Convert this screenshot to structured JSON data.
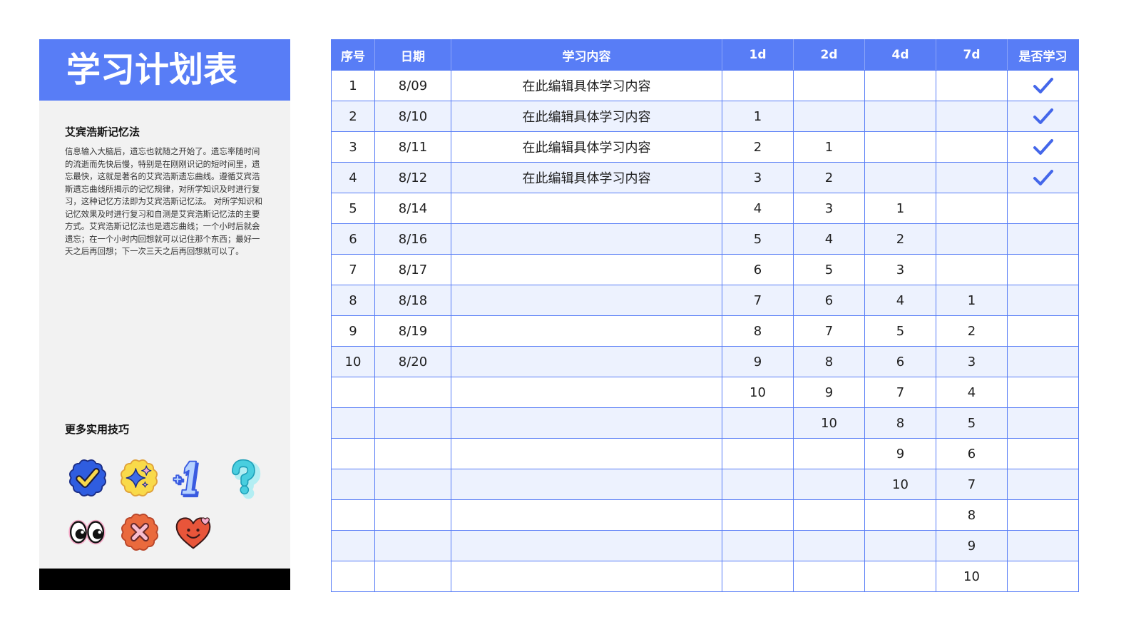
{
  "title": "学习计划表",
  "method": {
    "heading": "艾宾浩斯记忆法",
    "body": "信息输入大脑后，遗忘也就随之开始了。遗忘率随时间的流逝而先快后慢，特别是在刚刚识记的短时间里，遗忘最快，这就是著名的艾宾浩斯遗忘曲线。遵循艾宾浩斯遗忘曲线所揭示的记忆规律，对所学知识及时进行复习，这种记忆方法即为艾宾浩斯记忆法。 对所学知识和记忆效果及时进行复习和自测是艾宾浩斯记忆法的主要方式。艾宾浩斯记忆法也是遗忘曲线；一个小时后就会遗忘；在一个小时内回想就可以记住那个东西；最好一天之后再回想；下一次三天之后再回想就可以了。"
  },
  "tips": {
    "heading": "更多实用技巧",
    "stickers": [
      "check-badge-icon",
      "sparkle-badge-icon",
      "plus-one-icon",
      "question-mark-icon",
      "eyes-icon",
      "cross-badge-icon",
      "smiling-heart-icon"
    ]
  },
  "colors": {
    "accent": "#587DF6",
    "row_alt": "#EDF2FE",
    "panel": "#F2F2F2",
    "footer": "#000000",
    "check": "#4467EA"
  },
  "table": {
    "columns": [
      "序号",
      "日期",
      "学习内容",
      "1d",
      "2d",
      "4d",
      "7d",
      "是否学习"
    ],
    "rows": [
      {
        "no": "1",
        "date": "8/09",
        "content": "在此编辑具体学习内容",
        "d1": "",
        "d2": "",
        "d4": "",
        "d7": "",
        "studied": true
      },
      {
        "no": "2",
        "date": "8/10",
        "content": "在此编辑具体学习内容",
        "d1": "1",
        "d2": "",
        "d4": "",
        "d7": "",
        "studied": true
      },
      {
        "no": "3",
        "date": "8/11",
        "content": "在此编辑具体学习内容",
        "d1": "2",
        "d2": "1",
        "d4": "",
        "d7": "",
        "studied": true
      },
      {
        "no": "4",
        "date": "8/12",
        "content": "在此编辑具体学习内容",
        "d1": "3",
        "d2": "2",
        "d4": "",
        "d7": "",
        "studied": true
      },
      {
        "no": "5",
        "date": "8/14",
        "content": "",
        "d1": "4",
        "d2": "3",
        "d4": "1",
        "d7": "",
        "studied": false
      },
      {
        "no": "6",
        "date": "8/16",
        "content": "",
        "d1": "5",
        "d2": "4",
        "d4": "2",
        "d7": "",
        "studied": false
      },
      {
        "no": "7",
        "date": "8/17",
        "content": "",
        "d1": "6",
        "d2": "5",
        "d4": "3",
        "d7": "",
        "studied": false
      },
      {
        "no": "8",
        "date": "8/18",
        "content": "",
        "d1": "7",
        "d2": "6",
        "d4": "4",
        "d7": "1",
        "studied": false
      },
      {
        "no": "9",
        "date": "8/19",
        "content": "",
        "d1": "8",
        "d2": "7",
        "d4": "5",
        "d7": "2",
        "studied": false
      },
      {
        "no": "10",
        "date": "8/20",
        "content": "",
        "d1": "9",
        "d2": "8",
        "d4": "6",
        "d7": "3",
        "studied": false
      },
      {
        "no": "",
        "date": "",
        "content": "",
        "d1": "10",
        "d2": "9",
        "d4": "7",
        "d7": "4",
        "studied": false
      },
      {
        "no": "",
        "date": "",
        "content": "",
        "d1": "",
        "d2": "10",
        "d4": "8",
        "d7": "5",
        "studied": false
      },
      {
        "no": "",
        "date": "",
        "content": "",
        "d1": "",
        "d2": "",
        "d4": "9",
        "d7": "6",
        "studied": false
      },
      {
        "no": "",
        "date": "",
        "content": "",
        "d1": "",
        "d2": "",
        "d4": "10",
        "d7": "7",
        "studied": false
      },
      {
        "no": "",
        "date": "",
        "content": "",
        "d1": "",
        "d2": "",
        "d4": "",
        "d7": "8",
        "studied": false
      },
      {
        "no": "",
        "date": "",
        "content": "",
        "d1": "",
        "d2": "",
        "d4": "",
        "d7": "9",
        "studied": false
      },
      {
        "no": "",
        "date": "",
        "content": "",
        "d1": "",
        "d2": "",
        "d4": "",
        "d7": "10",
        "studied": false
      }
    ]
  }
}
